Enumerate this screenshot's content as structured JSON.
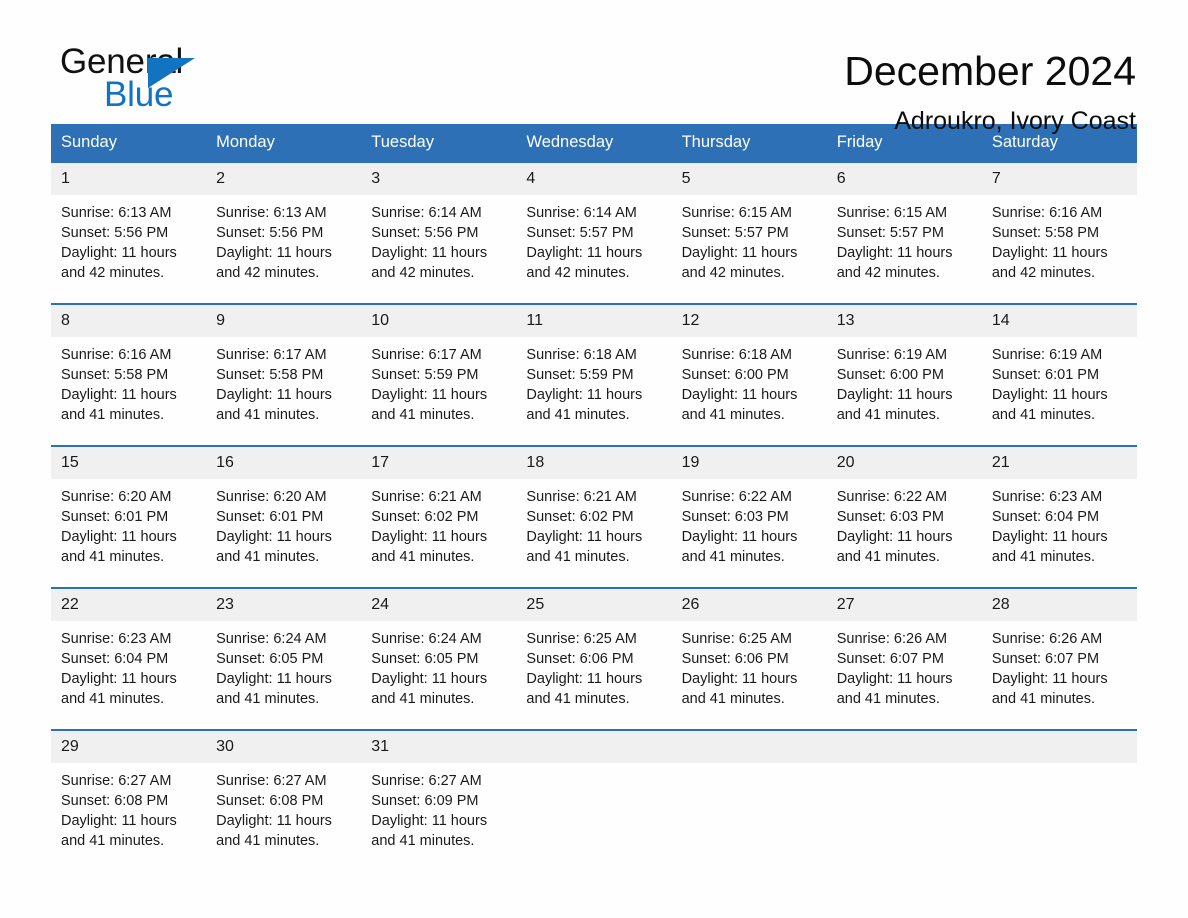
{
  "brand": {
    "name_part1": "General",
    "name_part2": "Blue",
    "accent_color": "#1273c0",
    "triangle_icon": "triangle-right-icon"
  },
  "header": {
    "title": "December 2024",
    "subtitle": "Adroukro, Ivory Coast"
  },
  "calendar": {
    "header_color": "#2d70b5",
    "daynum_band_color": "#f0f0f0",
    "weekdays": [
      "Sunday",
      "Monday",
      "Tuesday",
      "Wednesday",
      "Thursday",
      "Friday",
      "Saturday"
    ],
    "weeks": [
      [
        {
          "day": "1",
          "sunrise": "Sunrise: 6:13 AM",
          "sunset": "Sunset: 5:56 PM",
          "daylight1": "Daylight: 11 hours",
          "daylight2": "and 42 minutes."
        },
        {
          "day": "2",
          "sunrise": "Sunrise: 6:13 AM",
          "sunset": "Sunset: 5:56 PM",
          "daylight1": "Daylight: 11 hours",
          "daylight2": "and 42 minutes."
        },
        {
          "day": "3",
          "sunrise": "Sunrise: 6:14 AM",
          "sunset": "Sunset: 5:56 PM",
          "daylight1": "Daylight: 11 hours",
          "daylight2": "and 42 minutes."
        },
        {
          "day": "4",
          "sunrise": "Sunrise: 6:14 AM",
          "sunset": "Sunset: 5:57 PM",
          "daylight1": "Daylight: 11 hours",
          "daylight2": "and 42 minutes."
        },
        {
          "day": "5",
          "sunrise": "Sunrise: 6:15 AM",
          "sunset": "Sunset: 5:57 PM",
          "daylight1": "Daylight: 11 hours",
          "daylight2": "and 42 minutes."
        },
        {
          "day": "6",
          "sunrise": "Sunrise: 6:15 AM",
          "sunset": "Sunset: 5:57 PM",
          "daylight1": "Daylight: 11 hours",
          "daylight2": "and 42 minutes."
        },
        {
          "day": "7",
          "sunrise": "Sunrise: 6:16 AM",
          "sunset": "Sunset: 5:58 PM",
          "daylight1": "Daylight: 11 hours",
          "daylight2": "and 42 minutes."
        }
      ],
      [
        {
          "day": "8",
          "sunrise": "Sunrise: 6:16 AM",
          "sunset": "Sunset: 5:58 PM",
          "daylight1": "Daylight: 11 hours",
          "daylight2": "and 41 minutes."
        },
        {
          "day": "9",
          "sunrise": "Sunrise: 6:17 AM",
          "sunset": "Sunset: 5:58 PM",
          "daylight1": "Daylight: 11 hours",
          "daylight2": "and 41 minutes."
        },
        {
          "day": "10",
          "sunrise": "Sunrise: 6:17 AM",
          "sunset": "Sunset: 5:59 PM",
          "daylight1": "Daylight: 11 hours",
          "daylight2": "and 41 minutes."
        },
        {
          "day": "11",
          "sunrise": "Sunrise: 6:18 AM",
          "sunset": "Sunset: 5:59 PM",
          "daylight1": "Daylight: 11 hours",
          "daylight2": "and 41 minutes."
        },
        {
          "day": "12",
          "sunrise": "Sunrise: 6:18 AM",
          "sunset": "Sunset: 6:00 PM",
          "daylight1": "Daylight: 11 hours",
          "daylight2": "and 41 minutes."
        },
        {
          "day": "13",
          "sunrise": "Sunrise: 6:19 AM",
          "sunset": "Sunset: 6:00 PM",
          "daylight1": "Daylight: 11 hours",
          "daylight2": "and 41 minutes."
        },
        {
          "day": "14",
          "sunrise": "Sunrise: 6:19 AM",
          "sunset": "Sunset: 6:01 PM",
          "daylight1": "Daylight: 11 hours",
          "daylight2": "and 41 minutes."
        }
      ],
      [
        {
          "day": "15",
          "sunrise": "Sunrise: 6:20 AM",
          "sunset": "Sunset: 6:01 PM",
          "daylight1": "Daylight: 11 hours",
          "daylight2": "and 41 minutes."
        },
        {
          "day": "16",
          "sunrise": "Sunrise: 6:20 AM",
          "sunset": "Sunset: 6:01 PM",
          "daylight1": "Daylight: 11 hours",
          "daylight2": "and 41 minutes."
        },
        {
          "day": "17",
          "sunrise": "Sunrise: 6:21 AM",
          "sunset": "Sunset: 6:02 PM",
          "daylight1": "Daylight: 11 hours",
          "daylight2": "and 41 minutes."
        },
        {
          "day": "18",
          "sunrise": "Sunrise: 6:21 AM",
          "sunset": "Sunset: 6:02 PM",
          "daylight1": "Daylight: 11 hours",
          "daylight2": "and 41 minutes."
        },
        {
          "day": "19",
          "sunrise": "Sunrise: 6:22 AM",
          "sunset": "Sunset: 6:03 PM",
          "daylight1": "Daylight: 11 hours",
          "daylight2": "and 41 minutes."
        },
        {
          "day": "20",
          "sunrise": "Sunrise: 6:22 AM",
          "sunset": "Sunset: 6:03 PM",
          "daylight1": "Daylight: 11 hours",
          "daylight2": "and 41 minutes."
        },
        {
          "day": "21",
          "sunrise": "Sunrise: 6:23 AM",
          "sunset": "Sunset: 6:04 PM",
          "daylight1": "Daylight: 11 hours",
          "daylight2": "and 41 minutes."
        }
      ],
      [
        {
          "day": "22",
          "sunrise": "Sunrise: 6:23 AM",
          "sunset": "Sunset: 6:04 PM",
          "daylight1": "Daylight: 11 hours",
          "daylight2": "and 41 minutes."
        },
        {
          "day": "23",
          "sunrise": "Sunrise: 6:24 AM",
          "sunset": "Sunset: 6:05 PM",
          "daylight1": "Daylight: 11 hours",
          "daylight2": "and 41 minutes."
        },
        {
          "day": "24",
          "sunrise": "Sunrise: 6:24 AM",
          "sunset": "Sunset: 6:05 PM",
          "daylight1": "Daylight: 11 hours",
          "daylight2": "and 41 minutes."
        },
        {
          "day": "25",
          "sunrise": "Sunrise: 6:25 AM",
          "sunset": "Sunset: 6:06 PM",
          "daylight1": "Daylight: 11 hours",
          "daylight2": "and 41 minutes."
        },
        {
          "day": "26",
          "sunrise": "Sunrise: 6:25 AM",
          "sunset": "Sunset: 6:06 PM",
          "daylight1": "Daylight: 11 hours",
          "daylight2": "and 41 minutes."
        },
        {
          "day": "27",
          "sunrise": "Sunrise: 6:26 AM",
          "sunset": "Sunset: 6:07 PM",
          "daylight1": "Daylight: 11 hours",
          "daylight2": "and 41 minutes."
        },
        {
          "day": "28",
          "sunrise": "Sunrise: 6:26 AM",
          "sunset": "Sunset: 6:07 PM",
          "daylight1": "Daylight: 11 hours",
          "daylight2": "and 41 minutes."
        }
      ],
      [
        {
          "day": "29",
          "sunrise": "Sunrise: 6:27 AM",
          "sunset": "Sunset: 6:08 PM",
          "daylight1": "Daylight: 11 hours",
          "daylight2": "and 41 minutes."
        },
        {
          "day": "30",
          "sunrise": "Sunrise: 6:27 AM",
          "sunset": "Sunset: 6:08 PM",
          "daylight1": "Daylight: 11 hours",
          "daylight2": "and 41 minutes."
        },
        {
          "day": "31",
          "sunrise": "Sunrise: 6:27 AM",
          "sunset": "Sunset: 6:09 PM",
          "daylight1": "Daylight: 11 hours",
          "daylight2": "and 41 minutes."
        },
        {
          "day": "",
          "sunrise": "",
          "sunset": "",
          "daylight1": "",
          "daylight2": ""
        },
        {
          "day": "",
          "sunrise": "",
          "sunset": "",
          "daylight1": "",
          "daylight2": ""
        },
        {
          "day": "",
          "sunrise": "",
          "sunset": "",
          "daylight1": "",
          "daylight2": ""
        },
        {
          "day": "",
          "sunrise": "",
          "sunset": "",
          "daylight1": "",
          "daylight2": ""
        }
      ]
    ]
  }
}
